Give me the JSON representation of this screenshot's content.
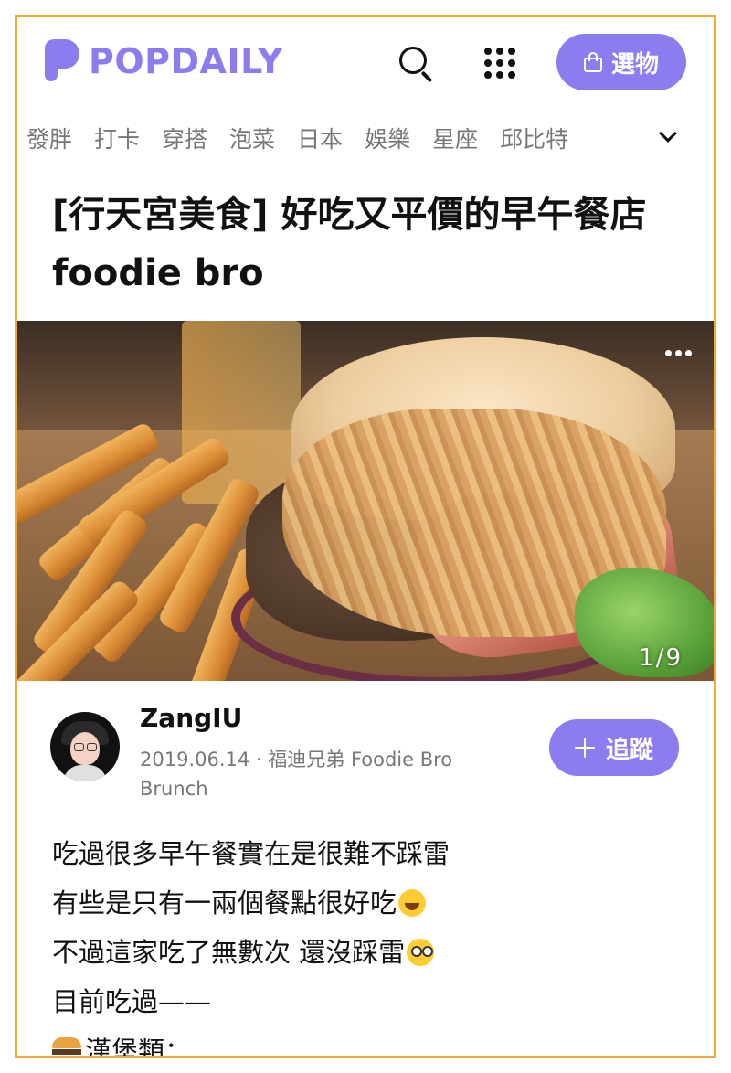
{
  "header": {
    "logo_text": "POPDAILY",
    "shop_label": "選物"
  },
  "categories": [
    "發胖",
    "打卡",
    "穿搭",
    "泡菜",
    "日本",
    "娛樂",
    "星座",
    "邱比特"
  ],
  "article": {
    "title": "[行天宮美食] 好吃又平價的早午餐店 foodie bro",
    "image_index": "1/9",
    "author": {
      "name": "ZangIU",
      "meta": "2019.06.14 · 福迪兄弟 Foodie Bro Brunch"
    },
    "follow_label": "追蹤",
    "body_lines": [
      "吃過很多早午餐實在是很難不踩雷",
      "有些是只有一兩個餐點很好吃",
      "不過這家吃了無數次 還沒踩雷",
      "目前吃過——",
      "漢堡類："
    ]
  },
  "colors": {
    "accent": "#8b7cf0",
    "frame_border": "#f2a93b"
  },
  "icons": [
    "search-icon",
    "grid-menu-icon",
    "shopping-bag-icon",
    "chevron-down-icon",
    "more-icon",
    "plus-icon"
  ]
}
